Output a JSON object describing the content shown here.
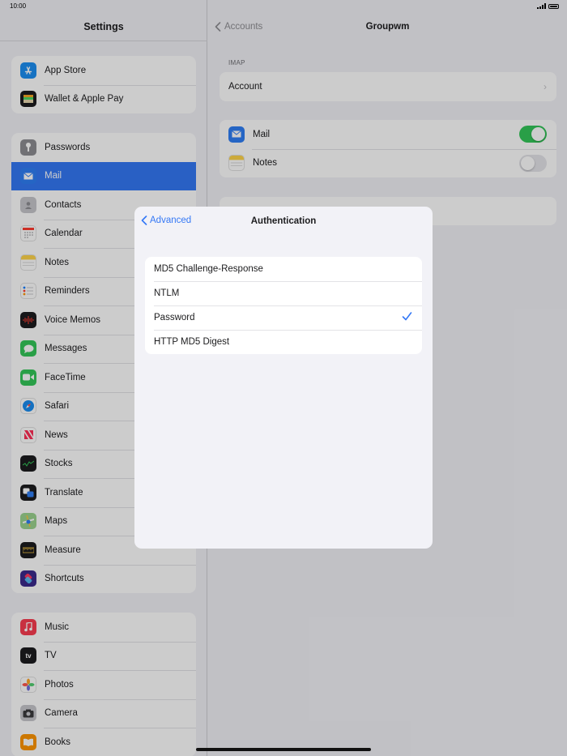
{
  "status_bar": {
    "time": "10:00"
  },
  "sidebar": {
    "title": "Settings",
    "groups": [
      [
        {
          "label": "App Store",
          "icon": "app-store-icon",
          "color": "#1c8ff3"
        },
        {
          "label": "Wallet & Apple Pay",
          "icon": "wallet-icon",
          "color": "#1c1c1e"
        }
      ],
      [
        {
          "label": "Passwords",
          "icon": "key-icon",
          "color": "#8e8e93"
        },
        {
          "label": "Mail",
          "icon": "mail-icon",
          "color": "#2f7ff6",
          "selected": true
        },
        {
          "label": "Contacts",
          "icon": "contacts-icon",
          "color": "#a9a9ae"
        },
        {
          "label": "Calendar",
          "icon": "calendar-icon",
          "color": "#ffffff"
        },
        {
          "label": "Notes",
          "icon": "notes-icon",
          "color": "#ffd54a"
        },
        {
          "label": "Reminders",
          "icon": "reminders-icon",
          "color": "#ffffff"
        },
        {
          "label": "Voice Memos",
          "icon": "voice-memos-icon",
          "color": "#1c1c1e"
        },
        {
          "label": "Messages",
          "icon": "messages-icon",
          "color": "#34c759"
        },
        {
          "label": "FaceTime",
          "icon": "facetime-icon",
          "color": "#34c759"
        },
        {
          "label": "Safari",
          "icon": "safari-icon",
          "color": "#1a8cf0"
        },
        {
          "label": "News",
          "icon": "news-icon",
          "color": "#ffffff"
        },
        {
          "label": "Stocks",
          "icon": "stocks-icon",
          "color": "#1c1c1e"
        },
        {
          "label": "Translate",
          "icon": "translate-icon",
          "color": "#1c1c1e"
        },
        {
          "label": "Maps",
          "icon": "maps-icon",
          "color": "#6cc070"
        },
        {
          "label": "Measure",
          "icon": "measure-icon",
          "color": "#1c1c1e"
        },
        {
          "label": "Shortcuts",
          "icon": "shortcuts-icon",
          "color": "#5b3fd6"
        }
      ],
      [
        {
          "label": "Music",
          "icon": "music-icon",
          "color": "#fa3c50"
        },
        {
          "label": "TV",
          "icon": "tv-icon",
          "color": "#1c1c1e"
        },
        {
          "label": "Photos",
          "icon": "photos-icon",
          "color": "#ffffff"
        },
        {
          "label": "Camera",
          "icon": "camera-icon",
          "color": "#8e8e93"
        },
        {
          "label": "Books",
          "icon": "books-icon",
          "color": "#ff9500"
        }
      ]
    ]
  },
  "detail": {
    "back_label": "Accounts",
    "title": "Groupwm",
    "section_label": "IMAP",
    "account_label": "Account",
    "mail_label": "Mail",
    "mail_enabled": true,
    "notes_label": "Notes",
    "notes_enabled": false
  },
  "modal": {
    "back_label": "Advanced",
    "title": "Authentication",
    "options": [
      {
        "label": "MD5 Challenge-Response",
        "selected": false
      },
      {
        "label": "NTLM",
        "selected": false
      },
      {
        "label": "Password",
        "selected": true
      },
      {
        "label": "HTTP MD5 Digest",
        "selected": false
      }
    ]
  },
  "colors": {
    "accent": "#3478f6",
    "toggle_on": "#34c759"
  }
}
